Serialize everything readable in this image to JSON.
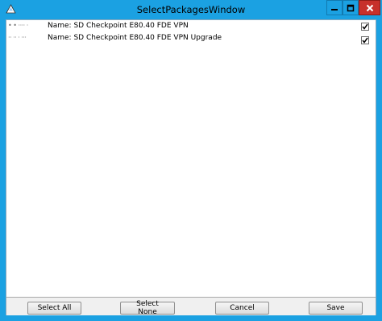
{
  "window": {
    "title": "SelectPackagesWindow"
  },
  "packages": [
    {
      "id": "• • ···· ·",
      "name": "Name: SD Checkpoint E80.40 FDE VPN",
      "checked": true
    },
    {
      "id": "·· ·· · ···",
      "name": "Name: SD Checkpoint E80.40 FDE VPN Upgrade",
      "checked": true
    }
  ],
  "buttons": {
    "select_all": "Select All",
    "select_none": "Select None",
    "cancel": "Cancel",
    "save": "Save"
  },
  "colors": {
    "frame": "#1ba1e2",
    "close": "#c7302b"
  }
}
